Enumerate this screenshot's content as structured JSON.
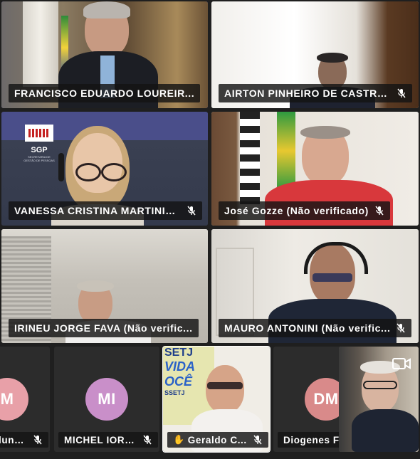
{
  "participants": [
    {
      "name": "FRANCISCO EDUARDO LOUREIR...",
      "muted": false,
      "active_speaker": true
    },
    {
      "name": "AIRTON PINHEIRO DE CASTRO...",
      "muted": true
    },
    {
      "name": "VANESSA CRISTINA MARTINIA...",
      "muted": true
    },
    {
      "name": "José Gozze (Não verificado)",
      "muted": true
    },
    {
      "name": "IRINEU JORGE FAVA (Não verific...",
      "muted": false
    },
    {
      "name": "MAURO ANTONINI (Não verific...",
      "muted": true
    }
  ],
  "bottom_row": [
    {
      "name": "lunh...",
      "initials": "M",
      "muted": true,
      "avatar_color": "#e8a0a8"
    },
    {
      "name": "MICHEL IORI...",
      "initials": "MI",
      "muted": true,
      "avatar_color": "#c98fc9"
    },
    {
      "name": "Geraldo C...",
      "muted": true,
      "hand_raised": true
    },
    {
      "name": "Diogenes F",
      "initials": "DM",
      "muted": false,
      "avatar_color": "#d98a8a"
    }
  ],
  "sgp_logo": {
    "acronym": "SGP",
    "subtitle": "SECRETARIA DE GESTÃO DE PESSOAS"
  },
  "poster_text": {
    "line1": "SETJ",
    "line2": "VIDA",
    "line3": "OCÊ",
    "line4": "SSETJ"
  },
  "colors": {
    "active_outline": "#6b6ee0",
    "name_bar_bg": "#141414"
  }
}
